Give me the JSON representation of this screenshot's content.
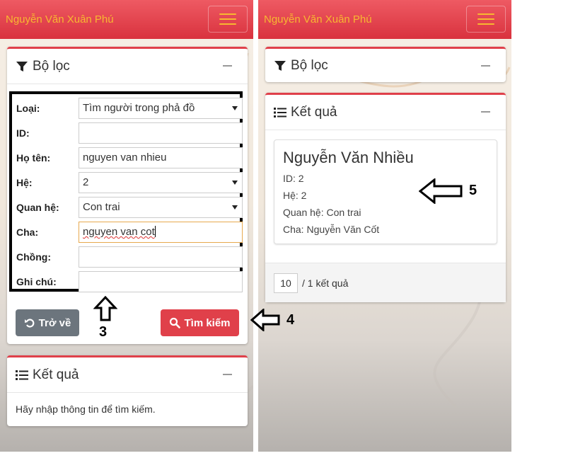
{
  "app": {
    "brand": "Nguyễn Văn Xuân Phú"
  },
  "filter": {
    "title": "Bộ lọc",
    "fields": [
      {
        "label": "Loại:",
        "value": "Tìm người trong phả đồ",
        "type": "select"
      },
      {
        "label": "ID:",
        "value": "",
        "type": "text"
      },
      {
        "label": "Họ tên:",
        "value": "nguyen van nhieu",
        "type": "text"
      },
      {
        "label": "Hệ:",
        "value": "2",
        "type": "select"
      },
      {
        "label": "Quan hệ:",
        "value": "Con trai",
        "type": "select"
      },
      {
        "label": "Cha:",
        "value": "nguyen van cot",
        "type": "text"
      },
      {
        "label": "Chồng:",
        "value": "",
        "type": "text"
      },
      {
        "label": "Ghi chú:",
        "value": "",
        "type": "text"
      }
    ],
    "back_label": "Trở về",
    "search_label": "Tìm kiếm"
  },
  "results_left": {
    "title": "Kết quả",
    "message": "Hãy nhập thông tin để tìm kiếm."
  },
  "results_right": {
    "title": "Kết quả",
    "item": {
      "name": "Nguyễn Văn Nhiều",
      "id_line": "ID: 2",
      "he_line": "Hệ: 2",
      "relation_line": "Quan hệ: Con trai",
      "father_line": "Cha: Nguyễn Văn Cốt"
    },
    "page_size": "10",
    "total_text": "/ 1 kết quả"
  },
  "annotations": {
    "n3": "3",
    "n4": "4",
    "n5": "5"
  },
  "colors": {
    "primary": "#e0404a",
    "brand_text": "#f7b731",
    "secondary": "#6c757d"
  }
}
